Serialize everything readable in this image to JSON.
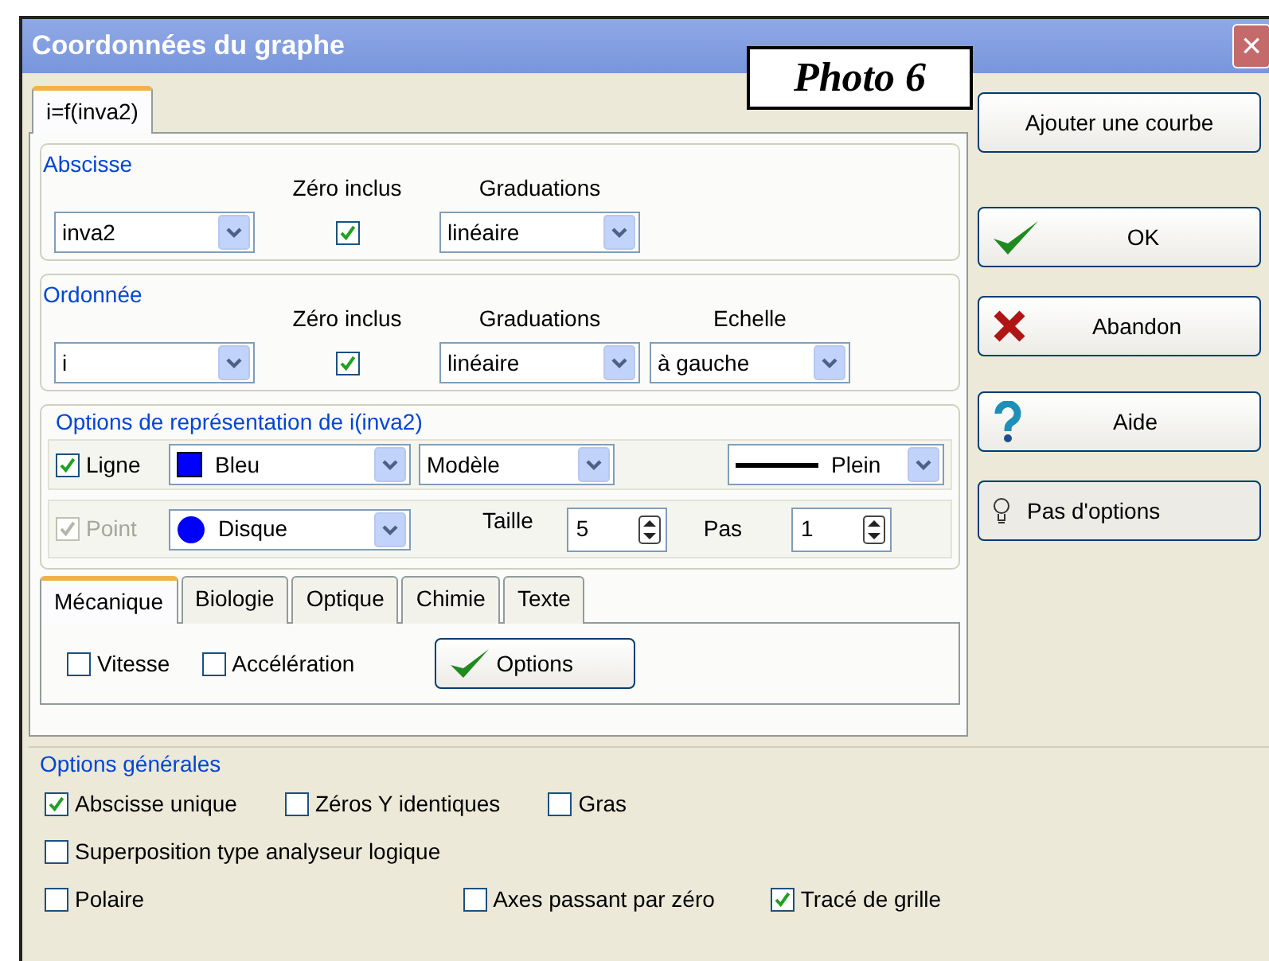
{
  "window": {
    "title": "Coordonnées du graphe",
    "close": "×"
  },
  "caption": "Photo 6",
  "curve_tabs": [
    {
      "label": "i=f(inva2)",
      "selected": true
    }
  ],
  "abscisse": {
    "legend": "Abscisse",
    "zero_label": "Zéro inclus",
    "grad_label": "Graduations",
    "variable": "inva2",
    "zero_included": true,
    "graduations": "linéaire"
  },
  "ordonnee": {
    "legend": "Ordonnée",
    "zero_label": "Zéro inclus",
    "grad_label": "Graduations",
    "scale_label": "Echelle",
    "variable": "i",
    "zero_included": true,
    "graduations": "linéaire",
    "scale": "à gauche"
  },
  "representation": {
    "legend": "Options de représentation de i(inva2)",
    "line": {
      "label": "Ligne",
      "checked": true,
      "color_name": "Bleu",
      "color": "#0000ff",
      "model": "Modèle",
      "style": "Plein"
    },
    "point": {
      "label": "Point",
      "checked": true,
      "disabled": true,
      "shape": "Disque",
      "size_label": "Taille",
      "size": "5",
      "step_label": "Pas",
      "step": "1"
    }
  },
  "category_tabs": [
    {
      "label": "Mécanique",
      "selected": true
    },
    {
      "label": "Biologie",
      "selected": false
    },
    {
      "label": "Optique",
      "selected": false
    },
    {
      "label": "Chimie",
      "selected": false
    },
    {
      "label": "Texte",
      "selected": false
    }
  ],
  "mechanics": {
    "options": [
      {
        "label": "Vitesse",
        "checked": false
      },
      {
        "label": "Accélération",
        "checked": false
      }
    ],
    "button": "Options"
  },
  "general": {
    "legend": "Options générales",
    "options": [
      {
        "label": "Abscisse unique",
        "checked": true
      },
      {
        "label": "Zéros Y identiques",
        "checked": false
      },
      {
        "label": "Gras",
        "checked": false
      },
      {
        "label": "Superposition type analyseur logique",
        "checked": false
      },
      {
        "label": "Polaire",
        "checked": false
      },
      {
        "label": "Axes passant par zéro",
        "checked": false
      },
      {
        "label": "Tracé de grille",
        "checked": true
      }
    ]
  },
  "buttons": [
    {
      "label": "Ajouter une courbe",
      "kind": "plain"
    },
    {
      "label": "OK",
      "kind": "check"
    },
    {
      "label": "Abandon",
      "kind": "cross"
    },
    {
      "label": "Aide",
      "kind": "help"
    },
    {
      "label": "Pas d'options",
      "kind": "bulb"
    }
  ]
}
